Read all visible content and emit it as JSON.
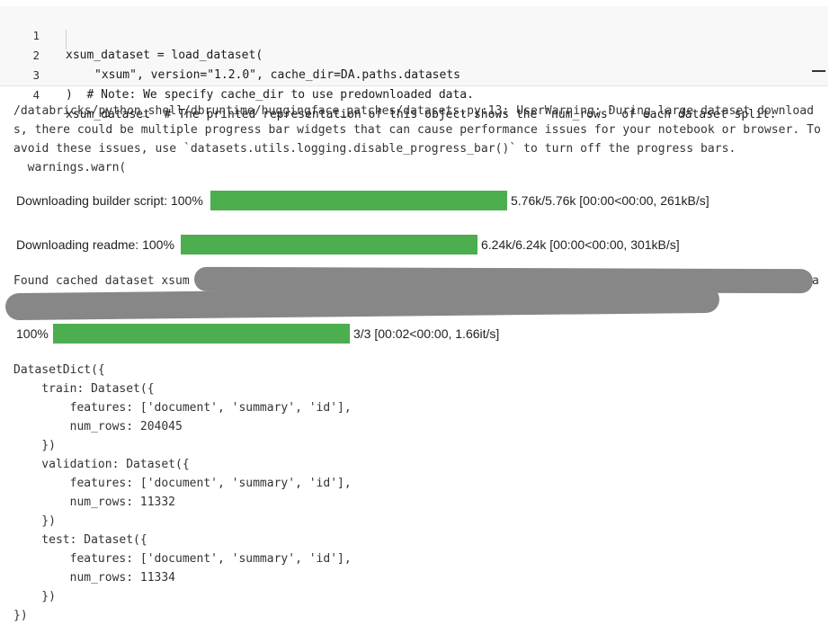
{
  "code": {
    "lines": [
      {
        "num": "1",
        "t1": "xsum_dataset = load_dataset("
      },
      {
        "num": "2",
        "t1": "\"xsum\", version=\"1.2.0\", cache_dir=DA.paths.datasets"
      },
      {
        "num": "3",
        "t1": ")  # Note: We specify cache_dir to use predownloaded data."
      },
      {
        "num": "4",
        "t1": "xsum_dataset  # The printed representation of this object shows the `num_rows` of each dataset split."
      }
    ]
  },
  "output": {
    "warning": "/databricks/python_shell/dbruntime/huggingface_patches/datasets.py:13: UserWarning: During large dataset downloads, there could be multiple progress bar widgets that can cause performance issues for your notebook or browser. To avoid these issues, use `datasets.utils.logging.disable_progress_bar()` to turn off the progress bars.",
    "warn_call": "  warnings.warn(",
    "progress": [
      {
        "label": "Downloading builder script: 100%",
        "status": "5.76k/5.76k [00:00<00:00, 261kB/s]",
        "fraction": 1.0
      },
      {
        "label": "Downloading readme: 100%",
        "status": "6.24k/6.24k [00:00<00:00, 301kB/s]",
        "fraction": 1.0
      },
      {
        "label": "100%",
        "status": "3/3 [00:02<00:00, 1.66it/s]",
        "fraction": 1.0
      }
    ],
    "cached_prefix": "Found cached dataset xsum",
    "cached_tail": "a",
    "dict_lines": [
      "DatasetDict({",
      "    train: Dataset({",
      "        features: ['document', 'summary', 'id'],",
      "        num_rows: 204045",
      "    })",
      "    validation: Dataset({",
      "        features: ['document', 'summary', 'id'],",
      "        num_rows: 11332",
      "    })",
      "    test: Dataset({",
      "        features: ['document', 'summary', 'id'],",
      "        num_rows: 11334",
      "    })",
      "})"
    ]
  },
  "colors": {
    "progress_fill": "#4cae4f",
    "redaction": "#878787"
  }
}
